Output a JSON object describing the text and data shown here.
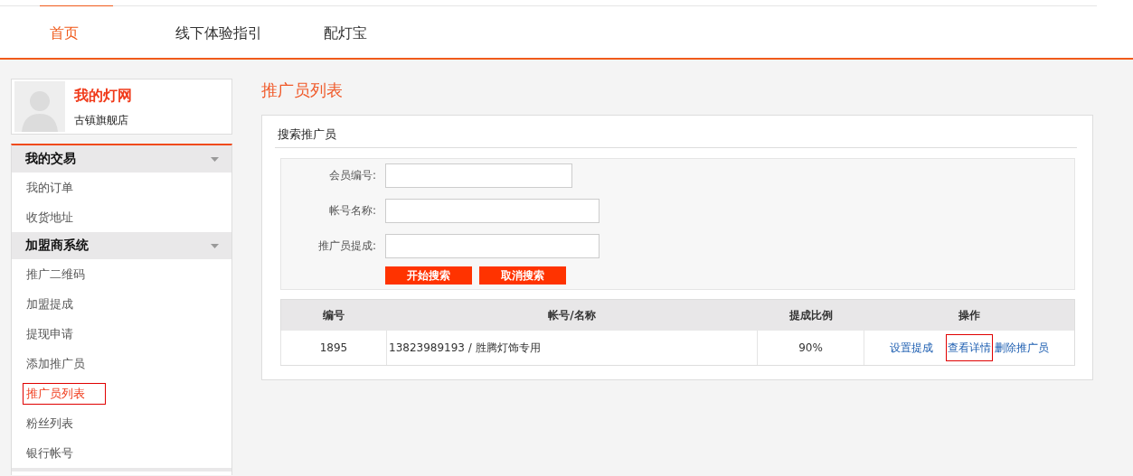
{
  "nav": {
    "items": [
      {
        "label": "首页",
        "selected": true
      },
      {
        "label": "线下体验指引",
        "selected": false
      },
      {
        "label": "配灯宝",
        "selected": false
      }
    ]
  },
  "profile": {
    "title": "我的灯网",
    "subtitle": "古镇旗舰店"
  },
  "sidebar": {
    "groups": [
      {
        "title": "我的交易",
        "expanded": true,
        "items": [
          {
            "label": "我的订单",
            "selected": false,
            "highlighted": false
          },
          {
            "label": "收货地址",
            "selected": false,
            "highlighted": false
          }
        ]
      },
      {
        "title": "加盟商系统",
        "expanded": true,
        "items": [
          {
            "label": "推广二维码",
            "selected": false,
            "highlighted": false
          },
          {
            "label": "加盟提成",
            "selected": false,
            "highlighted": false
          },
          {
            "label": "提现申请",
            "selected": false,
            "highlighted": false
          },
          {
            "label": "添加推广员",
            "selected": false,
            "highlighted": false
          },
          {
            "label": "推广员列表",
            "selected": true,
            "highlighted": true
          },
          {
            "label": "粉丝列表",
            "selected": false,
            "highlighted": false
          },
          {
            "label": "银行帐号",
            "selected": false,
            "highlighted": false
          }
        ]
      }
    ]
  },
  "page_title": "推广员列表",
  "search": {
    "title": "搜索推广员",
    "fields": [
      {
        "label": "会员编号:",
        "kind": "short"
      },
      {
        "label": "帐号名称:",
        "kind": "long"
      },
      {
        "label": "推广员提成:",
        "kind": "long"
      }
    ],
    "buttons": [
      "开始搜索",
      "取消搜索"
    ]
  },
  "table": {
    "columns": [
      "编号",
      "帐号/名称",
      "提成比例",
      "操作"
    ],
    "rows": [
      {
        "cells": [
          "1895",
          "13823989193 / 胜腾灯饰专用",
          "90%"
        ],
        "actions": [
          {
            "label": "设置提成",
            "highlighted": false
          },
          {
            "label": "查看详情",
            "highlighted": true
          },
          {
            "label": "删除推广员",
            "highlighted": false
          }
        ]
      }
    ]
  }
}
